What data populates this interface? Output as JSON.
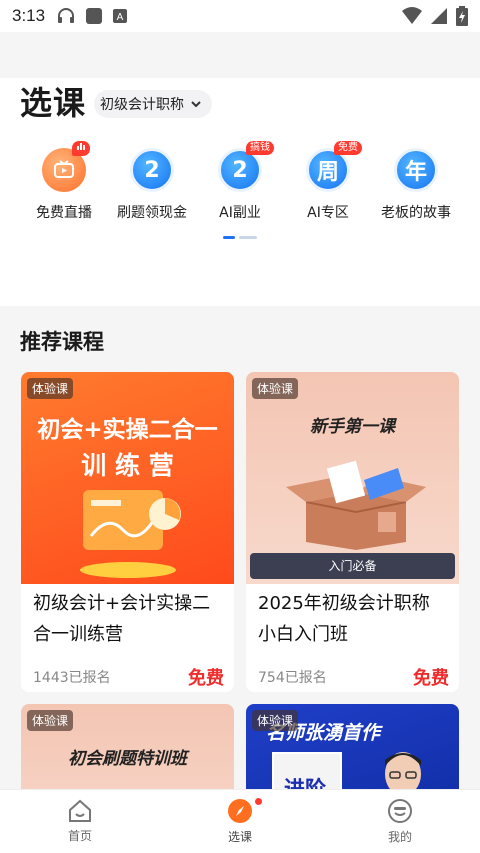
{
  "status": {
    "time": "3:13"
  },
  "header": {
    "title": "选课",
    "level": "初级会计职称"
  },
  "quick_links": [
    {
      "label": "免费直播",
      "icon": "tv-icon",
      "badge": "live",
      "glyph": ""
    },
    {
      "label": "刷题领现金",
      "icon": "number-2-icon",
      "badge": "",
      "glyph": "2"
    },
    {
      "label": "AI副业",
      "icon": "number-2-icon",
      "badge": "搞钱",
      "glyph": "2"
    },
    {
      "label": "AI专区",
      "icon": "week-icon",
      "badge": "免费",
      "glyph": "周"
    },
    {
      "label": "老板的故事",
      "icon": "year-icon",
      "badge": "",
      "glyph": "年"
    }
  ],
  "section": {
    "title": "推荐课程"
  },
  "courses": [
    {
      "tag": "体验课",
      "thumb_line1": "初会+实操二合一",
      "thumb_line2": "训 练 营",
      "title": "初级会计+会计实操二合一训练营",
      "enrolled": "1443已报名",
      "price": "免费"
    },
    {
      "tag": "体验课",
      "thumb_line1": "新手第一课",
      "thumb_banner": "入门必备",
      "title": "2025年初级会计职称 小白入门班",
      "enrolled": "754已报名",
      "price": "免费"
    },
    {
      "tag": "体验课",
      "thumb_line1": "初会刷题特训班"
    },
    {
      "tag": "体验课",
      "thumb_line1": "名师张湧首作",
      "book_title": "进阶思维"
    }
  ],
  "tabbar": [
    {
      "label": "首页",
      "icon": "home-icon"
    },
    {
      "label": "选课",
      "icon": "compass-icon"
    },
    {
      "label": "我的",
      "icon": "profile-icon"
    }
  ],
  "colors": {
    "accent": "#2173f5",
    "price": "#f02d2d",
    "orange": "#ff6f2a"
  }
}
